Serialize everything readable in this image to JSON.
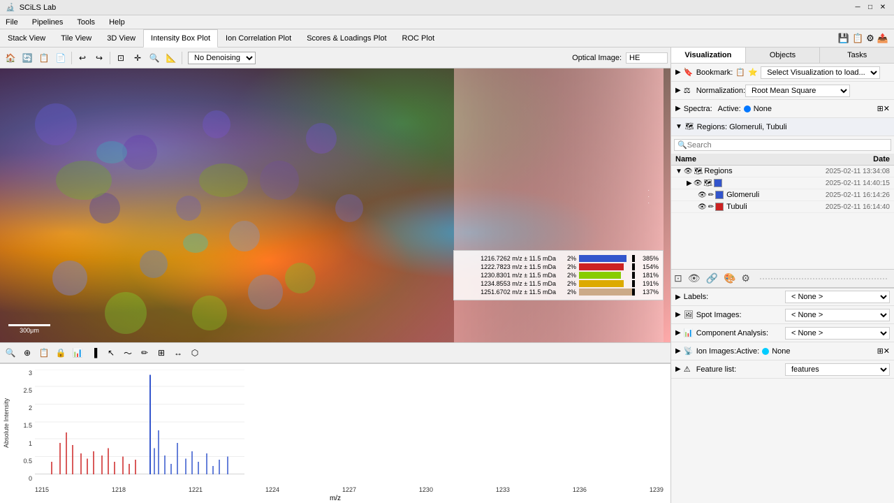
{
  "titleBar": {
    "title": "SCiLS Lab",
    "buttons": [
      "_",
      "□",
      "×"
    ]
  },
  "menuBar": {
    "items": [
      "File",
      "Pipelines",
      "Tools",
      "Help"
    ]
  },
  "tabs": {
    "items": [
      "Stack View",
      "Tile View",
      "3D View",
      "Intensity Box Plot",
      "Ion Correlation Plot",
      "Scores & Loadings Plot",
      "ROC Plot"
    ],
    "activeTab": "Intensity Box Plot"
  },
  "toolbar": {
    "denoiseLabel": "No Denoising",
    "opticalLabel": "Optical Image:",
    "opticalValue": "HE"
  },
  "legend": {
    "rows": [
      {
        "label": "1216.7262 m/z ± 11.5 mDa",
        "pctLeft": "2%",
        "pctRight": "385%",
        "color": "#3355cc",
        "barWidth": 0.85
      },
      {
        "label": "1222.7823 m/z ± 11.5 mDa",
        "pctLeft": "2%",
        "pctRight": "154%",
        "color": "#cc2222",
        "barWidth": 0.8
      },
      {
        "label": "1230.8301 m/z ± 11.5 mDa",
        "pctLeft": "2%",
        "pctRight": "181%",
        "color": "#88cc00",
        "barWidth": 0.75
      },
      {
        "label": "1234.8553 m/z ± 11.5 mDa",
        "pctLeft": "2%",
        "pctRight": "191%",
        "color": "#ddaa00",
        "barWidth": 0.8
      },
      {
        "label": "1251.6702 m/z ± 11.5 mDa",
        "pctLeft": "2%",
        "pctRight": "137%",
        "color": "#ccaa88",
        "barWidth": 1.0
      }
    ],
    "barLabels": [
      "80%",
      "85%",
      "75%",
      "80%",
      "100%"
    ]
  },
  "scaleBar": {
    "label": "300μm"
  },
  "spectrum": {
    "yLabel": "Absolute Intensity",
    "xLabel": "m/z",
    "yTicks": [
      "3",
      "2.5",
      "2",
      "1.5",
      "1",
      "0.5",
      "0"
    ],
    "xTicks": [
      "1215",
      "1218",
      "1221",
      "1224",
      "1227",
      "1230",
      "1233",
      "1236",
      "1239"
    ]
  },
  "rightPanel": {
    "tabs": [
      "Visualization",
      "Objects",
      "Tasks"
    ],
    "activeTab": "Visualization",
    "bookmark": {
      "label": "Bookmark:",
      "value": "Select Visualization to load..."
    },
    "normalization": {
      "label": "Normalization:",
      "value": "Root Mean Square"
    },
    "spectra": {
      "label": "Spectra:",
      "activeLabel": "Active:",
      "colorDot": "blue",
      "noneLabel": "None"
    },
    "regions": {
      "label": "Regions: Glomeruli, Tubuli"
    },
    "objects": {
      "searchPlaceholder": "Search",
      "columns": [
        "Name",
        "Date"
      ],
      "rows": [
        {
          "name": "Regions",
          "date": "2025-02-11 13:34:08",
          "level": 0,
          "expanded": true,
          "color": null
        },
        {
          "name": "",
          "date": "2025-02-11 14:40:15",
          "level": 1,
          "expanded": false,
          "color": "#3355cc"
        },
        {
          "name": "Glomeruli",
          "date": "2025-02-11 16:14:26",
          "level": 2,
          "expanded": false,
          "color": "#3355cc"
        },
        {
          "name": "Tubuli",
          "date": "2025-02-11 16:14:40",
          "level": 2,
          "expanded": false,
          "color": "#cc2222"
        }
      ]
    },
    "labels": {
      "label": "Labels:",
      "value": "< None >"
    },
    "spotImages": {
      "label": "Spot Images:",
      "value": "< None >"
    },
    "componentAnalysis": {
      "label": "Component Analysis:",
      "value": "< None >"
    },
    "ionImages": {
      "label": "Ion Images:",
      "activeLabel": "Active:",
      "colorDot": "cyan",
      "noneLabel": "None"
    },
    "featureList": {
      "label": "Feature list:",
      "value": "features"
    }
  }
}
